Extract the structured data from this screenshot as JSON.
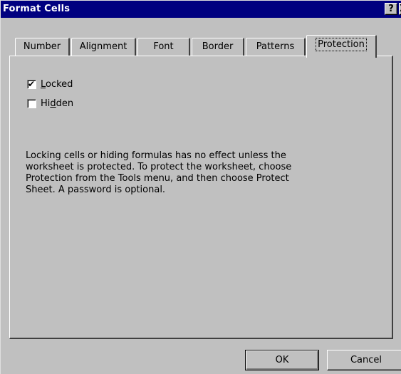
{
  "window": {
    "title": "Format Cells",
    "help_glyph": "?",
    "close_glyph": "X"
  },
  "tabs": [
    {
      "label": "Number",
      "active": false
    },
    {
      "label": "Alignment",
      "active": false
    },
    {
      "label": "Font",
      "active": false
    },
    {
      "label": "Border",
      "active": false
    },
    {
      "label": "Patterns",
      "active": false
    },
    {
      "label": "Protection",
      "active": true
    }
  ],
  "protection": {
    "locked": {
      "label_pre": "",
      "label_accel": "L",
      "label_post": "ocked",
      "checked": true
    },
    "hidden": {
      "label_pre": "Hi",
      "label_accel": "d",
      "label_post": "den",
      "checked": false
    },
    "info_lines": [
      "Locking cells or hiding formulas has no effect unless the",
      "worksheet is protected. To protect the worksheet, choose",
      "Protection from the Tools menu, and then choose Protect",
      "Sheet. A password is optional."
    ]
  },
  "buttons": {
    "ok": "OK",
    "cancel": "Cancel"
  },
  "colors": {
    "face": "#c0c0c0",
    "titlebar": "#000080",
    "title_text": "#ffffff"
  },
  "icons": {
    "check": "checkmark-icon"
  }
}
